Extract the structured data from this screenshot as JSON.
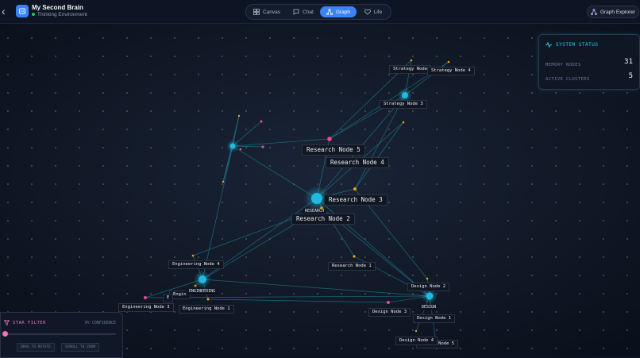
{
  "header": {
    "title": "My Second Brain",
    "subtitle": "Thinking Environment",
    "tabs": [
      {
        "label": "Canvas",
        "icon": "canvas-icon",
        "active": false
      },
      {
        "label": "Chat",
        "icon": "chat-icon",
        "active": false
      },
      {
        "label": "Graph",
        "icon": "graph-icon",
        "active": true
      },
      {
        "label": "Life",
        "icon": "heart-icon",
        "active": false
      }
    ],
    "explorer_label": "Graph Explorer"
  },
  "graph": {
    "nodes": {
      "strategy_node": "Strategy Node",
      "strategy_node_4": "Strategy Node 4",
      "strategy_node_3": "Strategy Node 3",
      "research_node_5": "Research Node 5",
      "research_node_4": "Research Node 4",
      "research_node_3": "Research Node 3",
      "research_node_2": "Research Node 2",
      "research_node_1": "Research Node 1",
      "engineering_node_4": "Engineering Node 4",
      "engineering_node_3": "Engineering Node 3",
      "engineering_node_1": "Engineering Node 1",
      "engineering_node_partial": "Engin",
      "engineering_node_partial_2": "E",
      "design_node_2": "Design Node 2",
      "design_node_3": "Design Node 3",
      "design_node_1": "Design Node 1",
      "design_node_4": "Design Node 4",
      "design_node_5_partial": "Design Node 5"
    },
    "clusters": {
      "research": "RESEARCH",
      "engineering": "ENGINEERING",
      "design": "DESIGN"
    },
    "colors": {
      "cluster": "#22b8e0",
      "note": "#ec4899",
      "idea": "#f59e0b",
      "edge": "#1f8a9e"
    }
  },
  "system_status": {
    "title": "SYSTEM STATUS",
    "memory_nodes_label": "MEMORY NODES",
    "memory_nodes_value": "31",
    "active_clusters_label": "ACTIVE CLUSTERS",
    "active_clusters_value": "5"
  },
  "star_filter": {
    "title": "STAR FILTER",
    "confidence": "0% CONFIDENCE",
    "value": 0,
    "hint_rotate": "DRAG TO ROTATE",
    "hint_zoom": "SCROLL TO ZOOM"
  }
}
